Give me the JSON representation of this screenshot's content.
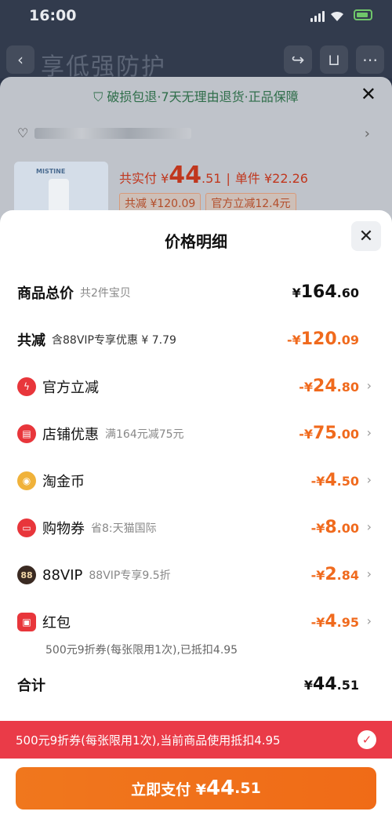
{
  "status": {
    "time": "16:00"
  },
  "background": {
    "title": "享低强防护",
    "guarantee": "破损包退·7天无理由退货·正品保障",
    "product_brand": "MISTINE",
    "pay_prefix": "共实付 ¥",
    "pay_int": "44",
    "pay_dec": ".51",
    "unit_price": "单件 ¥22.26",
    "tag1": "共减 ¥120.09",
    "tag2": "官方立减12.4元"
  },
  "sheet": {
    "title": "价格明细",
    "total": {
      "label": "商品总价",
      "sub": "共2件宝贝",
      "sym": "¥",
      "int": "164",
      "dec": ".60"
    },
    "reduce": {
      "label": "共减",
      "sub": "含88VIP专享优惠 ¥ 7.79",
      "sym": "-¥",
      "int": "120",
      "dec": ".09"
    },
    "items": [
      {
        "label": "官方立减",
        "sub": "",
        "sym": "-¥",
        "int": "24",
        "dec": ".80",
        "icon": "lightning-icon"
      },
      {
        "label": "店铺优惠",
        "sub": "满164元减75元",
        "sym": "-¥",
        "int": "75",
        "dec": ".00",
        "icon": "shop-icon"
      },
      {
        "label": "淘金币",
        "sub": "",
        "sym": "-¥",
        "int": "4",
        "dec": ".50",
        "icon": "coin-icon"
      },
      {
        "label": "购物券",
        "sub": "省8:天猫国际",
        "sym": "-¥",
        "int": "8",
        "dec": ".00",
        "icon": "ticket-icon"
      },
      {
        "label": "88VIP",
        "sub": "88VIP专享9.5折",
        "sym": "-¥",
        "int": "2",
        "dec": ".84",
        "icon": "vip-icon"
      },
      {
        "label": "红包",
        "sub": "",
        "sym": "-¥",
        "int": "4",
        "dec": ".95",
        "icon": "red-packet-icon"
      }
    ],
    "redpacket_note": "500元9折券(每张限用1次),已抵扣4.95",
    "sum": {
      "label": "合计",
      "sym": "¥",
      "int": "44",
      "dec": ".51"
    }
  },
  "banner": {
    "text": "500元9折券(每张限用1次),当前商品使用抵扣4.95"
  },
  "pay_button": {
    "label": "立即支付 ¥",
    "int": "44",
    "dec": ".51"
  },
  "colors": {
    "accent": "#f06a1d",
    "banner": "#ea3b48",
    "pay": "#f0771d"
  }
}
